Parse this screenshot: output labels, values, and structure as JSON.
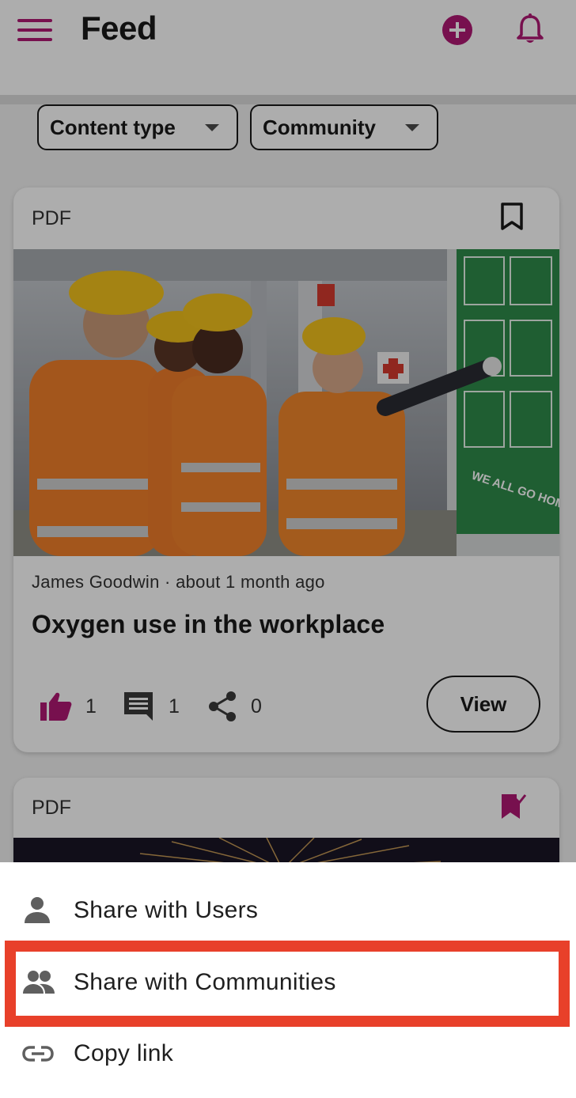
{
  "header": {
    "title": "Feed",
    "icons": [
      "menu-icon",
      "add-circle-icon",
      "notifications-icon"
    ],
    "accent_color": "#b01874"
  },
  "filters": [
    {
      "label": "Content type"
    },
    {
      "label": "Community"
    }
  ],
  "cards": [
    {
      "type_label": "PDF",
      "bookmarked": false,
      "image": "workers in orange safety vests and yellow hard hats looking at a green safety poster",
      "poster_text": "WE ALL GO HOME SAFE.",
      "author": "James Goodwin",
      "time": "about 1 month ago",
      "meta_separator": " · ",
      "title": "Oxygen use in the workplace",
      "likes": "1",
      "comments": "1",
      "shares": "0",
      "view_label": "View",
      "liked": true
    },
    {
      "type_label": "PDF",
      "bookmarked": true,
      "image": "fireworks"
    }
  ],
  "share_menu": {
    "items": [
      {
        "label": "Share with Users",
        "icon": "person-icon"
      },
      {
        "label": "Share with Communities",
        "icon": "group-icon",
        "highlighted": true
      },
      {
        "label": "Copy link",
        "icon": "link-icon"
      }
    ],
    "highlight_color": "#e8402a"
  }
}
